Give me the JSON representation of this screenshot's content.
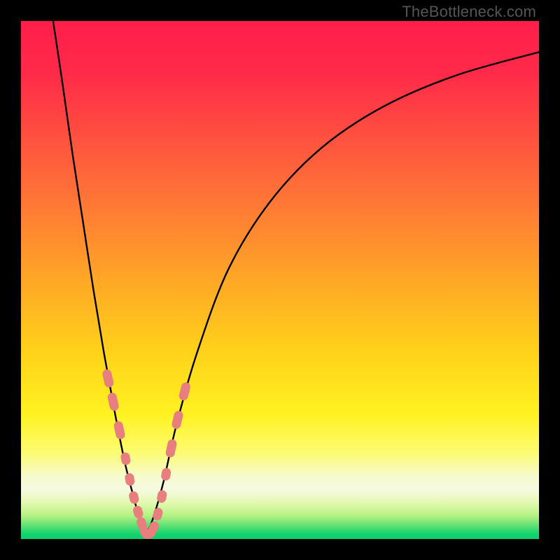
{
  "watermark": "TheBottleneck.com",
  "gradient_stops": [
    {
      "offset": 0.0,
      "color": "#ff1e4b"
    },
    {
      "offset": 0.1,
      "color": "#ff2a49"
    },
    {
      "offset": 0.22,
      "color": "#ff4f40"
    },
    {
      "offset": 0.36,
      "color": "#ff7a35"
    },
    {
      "offset": 0.5,
      "color": "#ffa726"
    },
    {
      "offset": 0.64,
      "color": "#ffd21a"
    },
    {
      "offset": 0.76,
      "color": "#fff222"
    },
    {
      "offset": 0.83,
      "color": "#fdfb6e"
    },
    {
      "offset": 0.88,
      "color": "#f6facf"
    },
    {
      "offset": 0.905,
      "color": "#f6fae0"
    },
    {
      "offset": 0.93,
      "color": "#e3f9b0"
    },
    {
      "offset": 0.955,
      "color": "#b6f183"
    },
    {
      "offset": 0.975,
      "color": "#5bdf72"
    },
    {
      "offset": 0.99,
      "color": "#14d46f"
    },
    {
      "offset": 1.0,
      "color": "#0fcf6e"
    }
  ],
  "chart_data": {
    "type": "line",
    "title": "",
    "xlabel": "",
    "ylabel": "",
    "xlim": [
      0,
      100
    ],
    "ylim": [
      0,
      100
    ],
    "grid": false,
    "legend": false,
    "note": "Values estimated from pixel positions; y=0 is bottom (green), y=100 is top (red). Two V-shaped curves meeting near x≈24, y≈0.",
    "series": [
      {
        "name": "left-branch",
        "x": [
          6.2,
          8,
          10,
          12,
          14,
          16,
          18,
          20,
          21.5,
          23,
          24
        ],
        "y": [
          100,
          88,
          74,
          61,
          48,
          36,
          25,
          15,
          9,
          3.5,
          0.5
        ]
      },
      {
        "name": "right-branch",
        "x": [
          24,
          25.5,
          27.5,
          30,
          34,
          40,
          48,
          58,
          70,
          84,
          100
        ],
        "y": [
          0.5,
          4,
          11,
          22,
          36,
          52,
          65,
          75.5,
          83.5,
          89.5,
          94
        ]
      }
    ],
    "markers": {
      "name": "salmon-bead-markers",
      "color": "#e87f7e",
      "note": "Rounded-capsule markers along the lower portion of both branches",
      "points_xy": [
        [
          16.8,
          31
        ],
        [
          17.8,
          26.5
        ],
        [
          19.0,
          21
        ],
        [
          20.2,
          15.5
        ],
        [
          21.0,
          11.5
        ],
        [
          21.8,
          8.0
        ],
        [
          22.6,
          5.2
        ],
        [
          23.3,
          3.0
        ],
        [
          24.0,
          1.2
        ],
        [
          24.8,
          1.0
        ],
        [
          25.6,
          2.2
        ],
        [
          26.4,
          4.8
        ],
        [
          27.2,
          8.2
        ],
        [
          28.0,
          12.5
        ],
        [
          29.0,
          17.5
        ],
        [
          30.2,
          23.0
        ],
        [
          31.6,
          28.5
        ]
      ]
    }
  }
}
